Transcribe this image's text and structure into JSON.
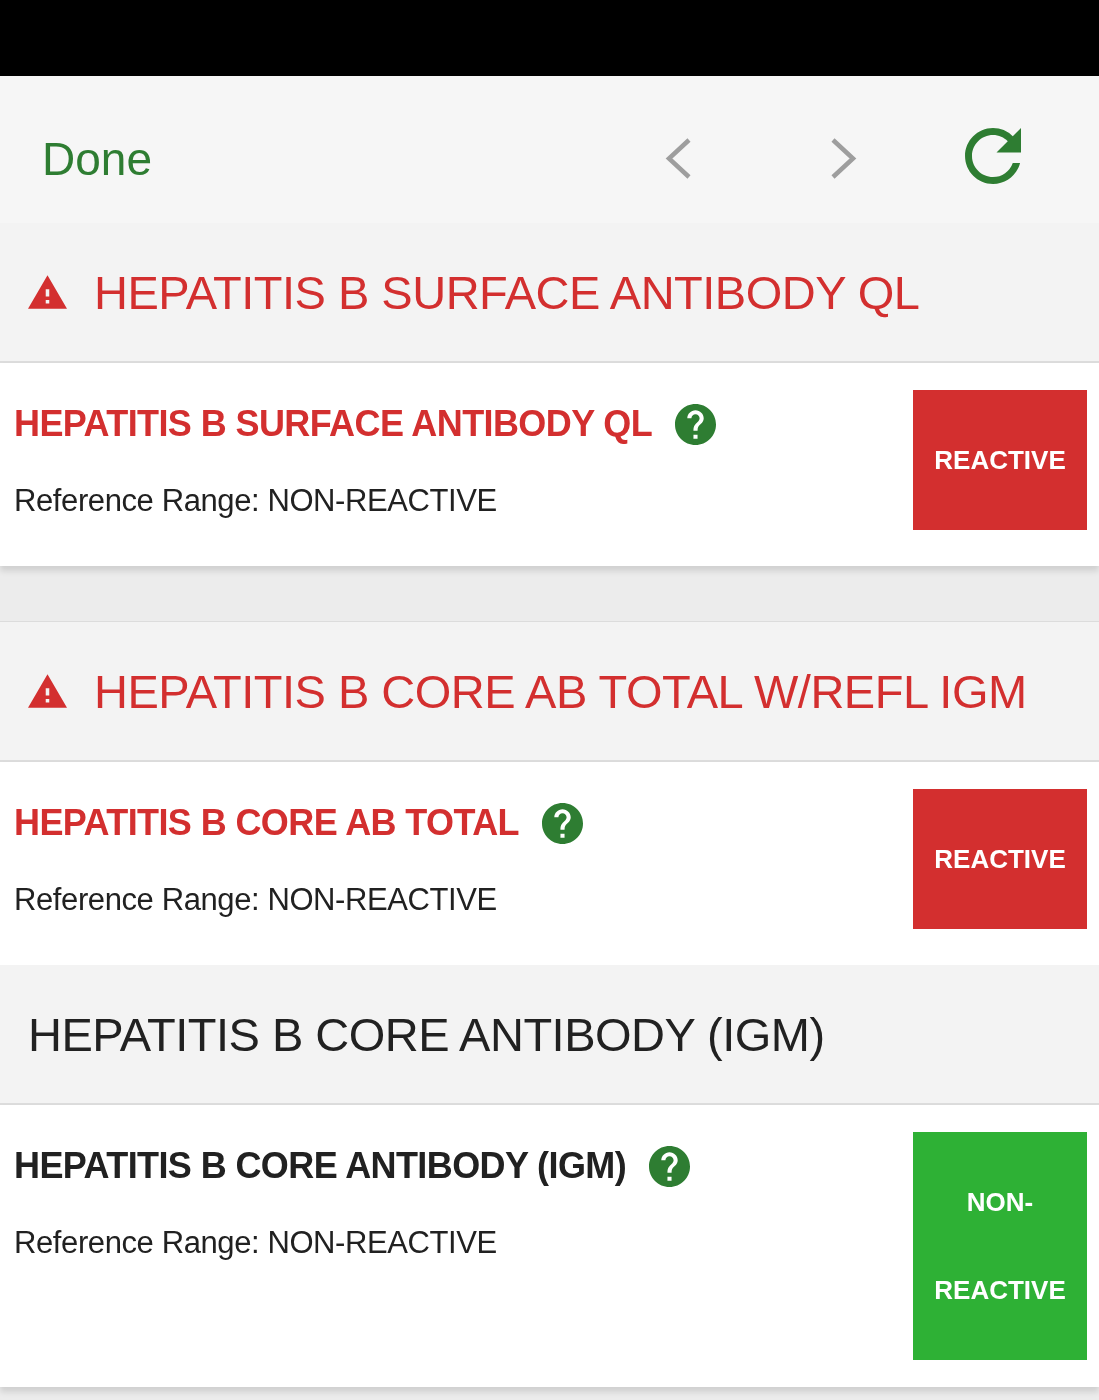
{
  "toolbar": {
    "done": "Done"
  },
  "panels": [
    {
      "sections": [
        {
          "title": "HEPATITIS B SURFACE ANTIBODY QL",
          "flagged": true,
          "result": {
            "name": "HEPATITIS B SURFACE ANTIBODY QL",
            "reference_range": "Reference Range: NON-REACTIVE",
            "value": "REACTIVE",
            "abnormal": true
          }
        }
      ]
    },
    {
      "sections": [
        {
          "title": "HEPATITIS B CORE AB TOTAL W/REFL IGM",
          "flagged": true,
          "result": {
            "name": "HEPATITIS B CORE AB TOTAL",
            "reference_range": "Reference Range: NON-REACTIVE",
            "value": "REACTIVE",
            "abnormal": true
          }
        },
        {
          "title": "HEPATITIS B CORE ANTIBODY (IGM)",
          "flagged": false,
          "result": {
            "name": "HEPATITIS B CORE ANTIBODY (IGM)",
            "reference_range": "Reference Range: NON-REACTIVE",
            "value": "NON-REACTIVE",
            "abnormal": false
          }
        }
      ]
    }
  ]
}
